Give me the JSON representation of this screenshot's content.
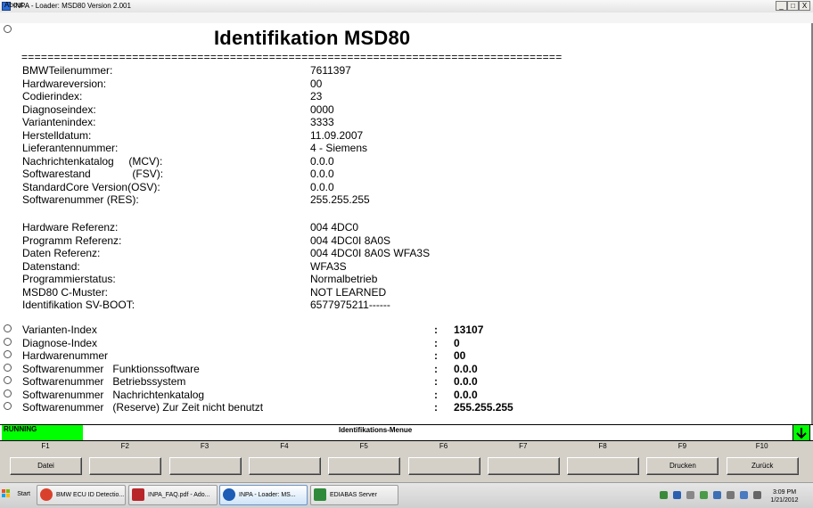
{
  "window": {
    "title": "INPA - Loader: MSD80 Version 2.001",
    "minimize": "_",
    "maximize": "□",
    "close": "X"
  },
  "menu": {
    "about": "About..."
  },
  "screen": {
    "title": "Identifikation MSD80",
    "separator": "===================================================================================",
    "ident_rows": [
      {
        "label": "BMWTeilenummer:",
        "value": "7611397"
      },
      {
        "label": "Hardwareversion:",
        "value": "00"
      },
      {
        "label": "Codierindex:",
        "value": "23"
      },
      {
        "label": "Diagnoseindex:",
        "value": "0000"
      },
      {
        "label": "Variantenindex:",
        "value": "3333"
      },
      {
        "label": "Herstelldatum:",
        "value": "11.09.2007"
      },
      {
        "label": "Lieferantennummer:",
        "value": "4 - Siemens"
      },
      {
        "label": "Nachrichtenkatalog     (MCV):",
        "value": "0.0.0"
      },
      {
        "label": "Softwarestand              (FSV):",
        "value": "0.0.0"
      },
      {
        "label": "StandardCore Version(OSV):",
        "value": "0.0.0"
      },
      {
        "label": "Softwarenummer (RES):",
        "value": "255.255.255"
      }
    ],
    "ref_rows": [
      {
        "label": "Hardware Referenz:",
        "value": "004 4DC0"
      },
      {
        "label": "Programm Referenz:",
        "value": "004 4DC0I 8A0S"
      },
      {
        "label": "Daten Referenz:",
        "value": "004 4DC0I 8A0S WFA3S"
      },
      {
        "label": "Datenstand:",
        "value": "WFA3S"
      },
      {
        "label": "Programmierstatus:",
        "value": "Normalbetrieb"
      },
      {
        "label": "MSD80 C-Muster:",
        "value": "NOT LEARNED"
      },
      {
        "label": "Identifikation SV-BOOT:",
        "value": "6577975211------"
      }
    ],
    "option_rows": [
      {
        "label": "Varianten-Index",
        "colon": ":",
        "value": "13107"
      },
      {
        "label": "Diagnose-Index",
        "colon": ":",
        "value": "0"
      },
      {
        "label": "Hardwarenummer",
        "colon": ":",
        "value": "00"
      },
      {
        "label": "Softwarenummer   Funktionssoftware",
        "colon": ":",
        "value": "0.0.0"
      },
      {
        "label": "Softwarenummer   Betriebssystem",
        "colon": ":",
        "value": "0.0.0"
      },
      {
        "label": "Softwarenummer   Nachrichtenkatalog",
        "colon": ":",
        "value": "0.0.0"
      },
      {
        "label": "Softwarenummer   (Reserve) Zur Zeit nicht benutzt",
        "colon": ":",
        "value": "255.255.255"
      }
    ]
  },
  "status": {
    "running": "RUNNING",
    "menu_title": "Identifikations-Menue",
    "scroll_icon": "arrow-down-icon"
  },
  "fkeys": [
    {
      "key": "F1",
      "label": "Datei"
    },
    {
      "key": "F2",
      "label": ""
    },
    {
      "key": "F3",
      "label": ""
    },
    {
      "key": "F4",
      "label": ""
    },
    {
      "key": "F5",
      "label": ""
    },
    {
      "key": "F6",
      "label": ""
    },
    {
      "key": "F7",
      "label": ""
    },
    {
      "key": "F8",
      "label": ""
    },
    {
      "key": "F9",
      "label": "Drucken"
    },
    {
      "key": "F10",
      "label": "Zurück"
    }
  ],
  "taskbar": {
    "start": "Start",
    "items": [
      {
        "label": "BMW ECU ID Detectio...",
        "icon": "chrome-icon",
        "active": false
      },
      {
        "label": "INPA_FAQ.pdf - Ado...",
        "icon": "pdf-icon",
        "active": false
      },
      {
        "label": "INPA - Loader: MS...",
        "icon": "bmw-icon",
        "active": true
      },
      {
        "label": "EDIABAS Server",
        "icon": "ediabas-icon",
        "active": false
      }
    ],
    "clock_time": "3:09 PM",
    "clock_date": "1/21/2012"
  }
}
